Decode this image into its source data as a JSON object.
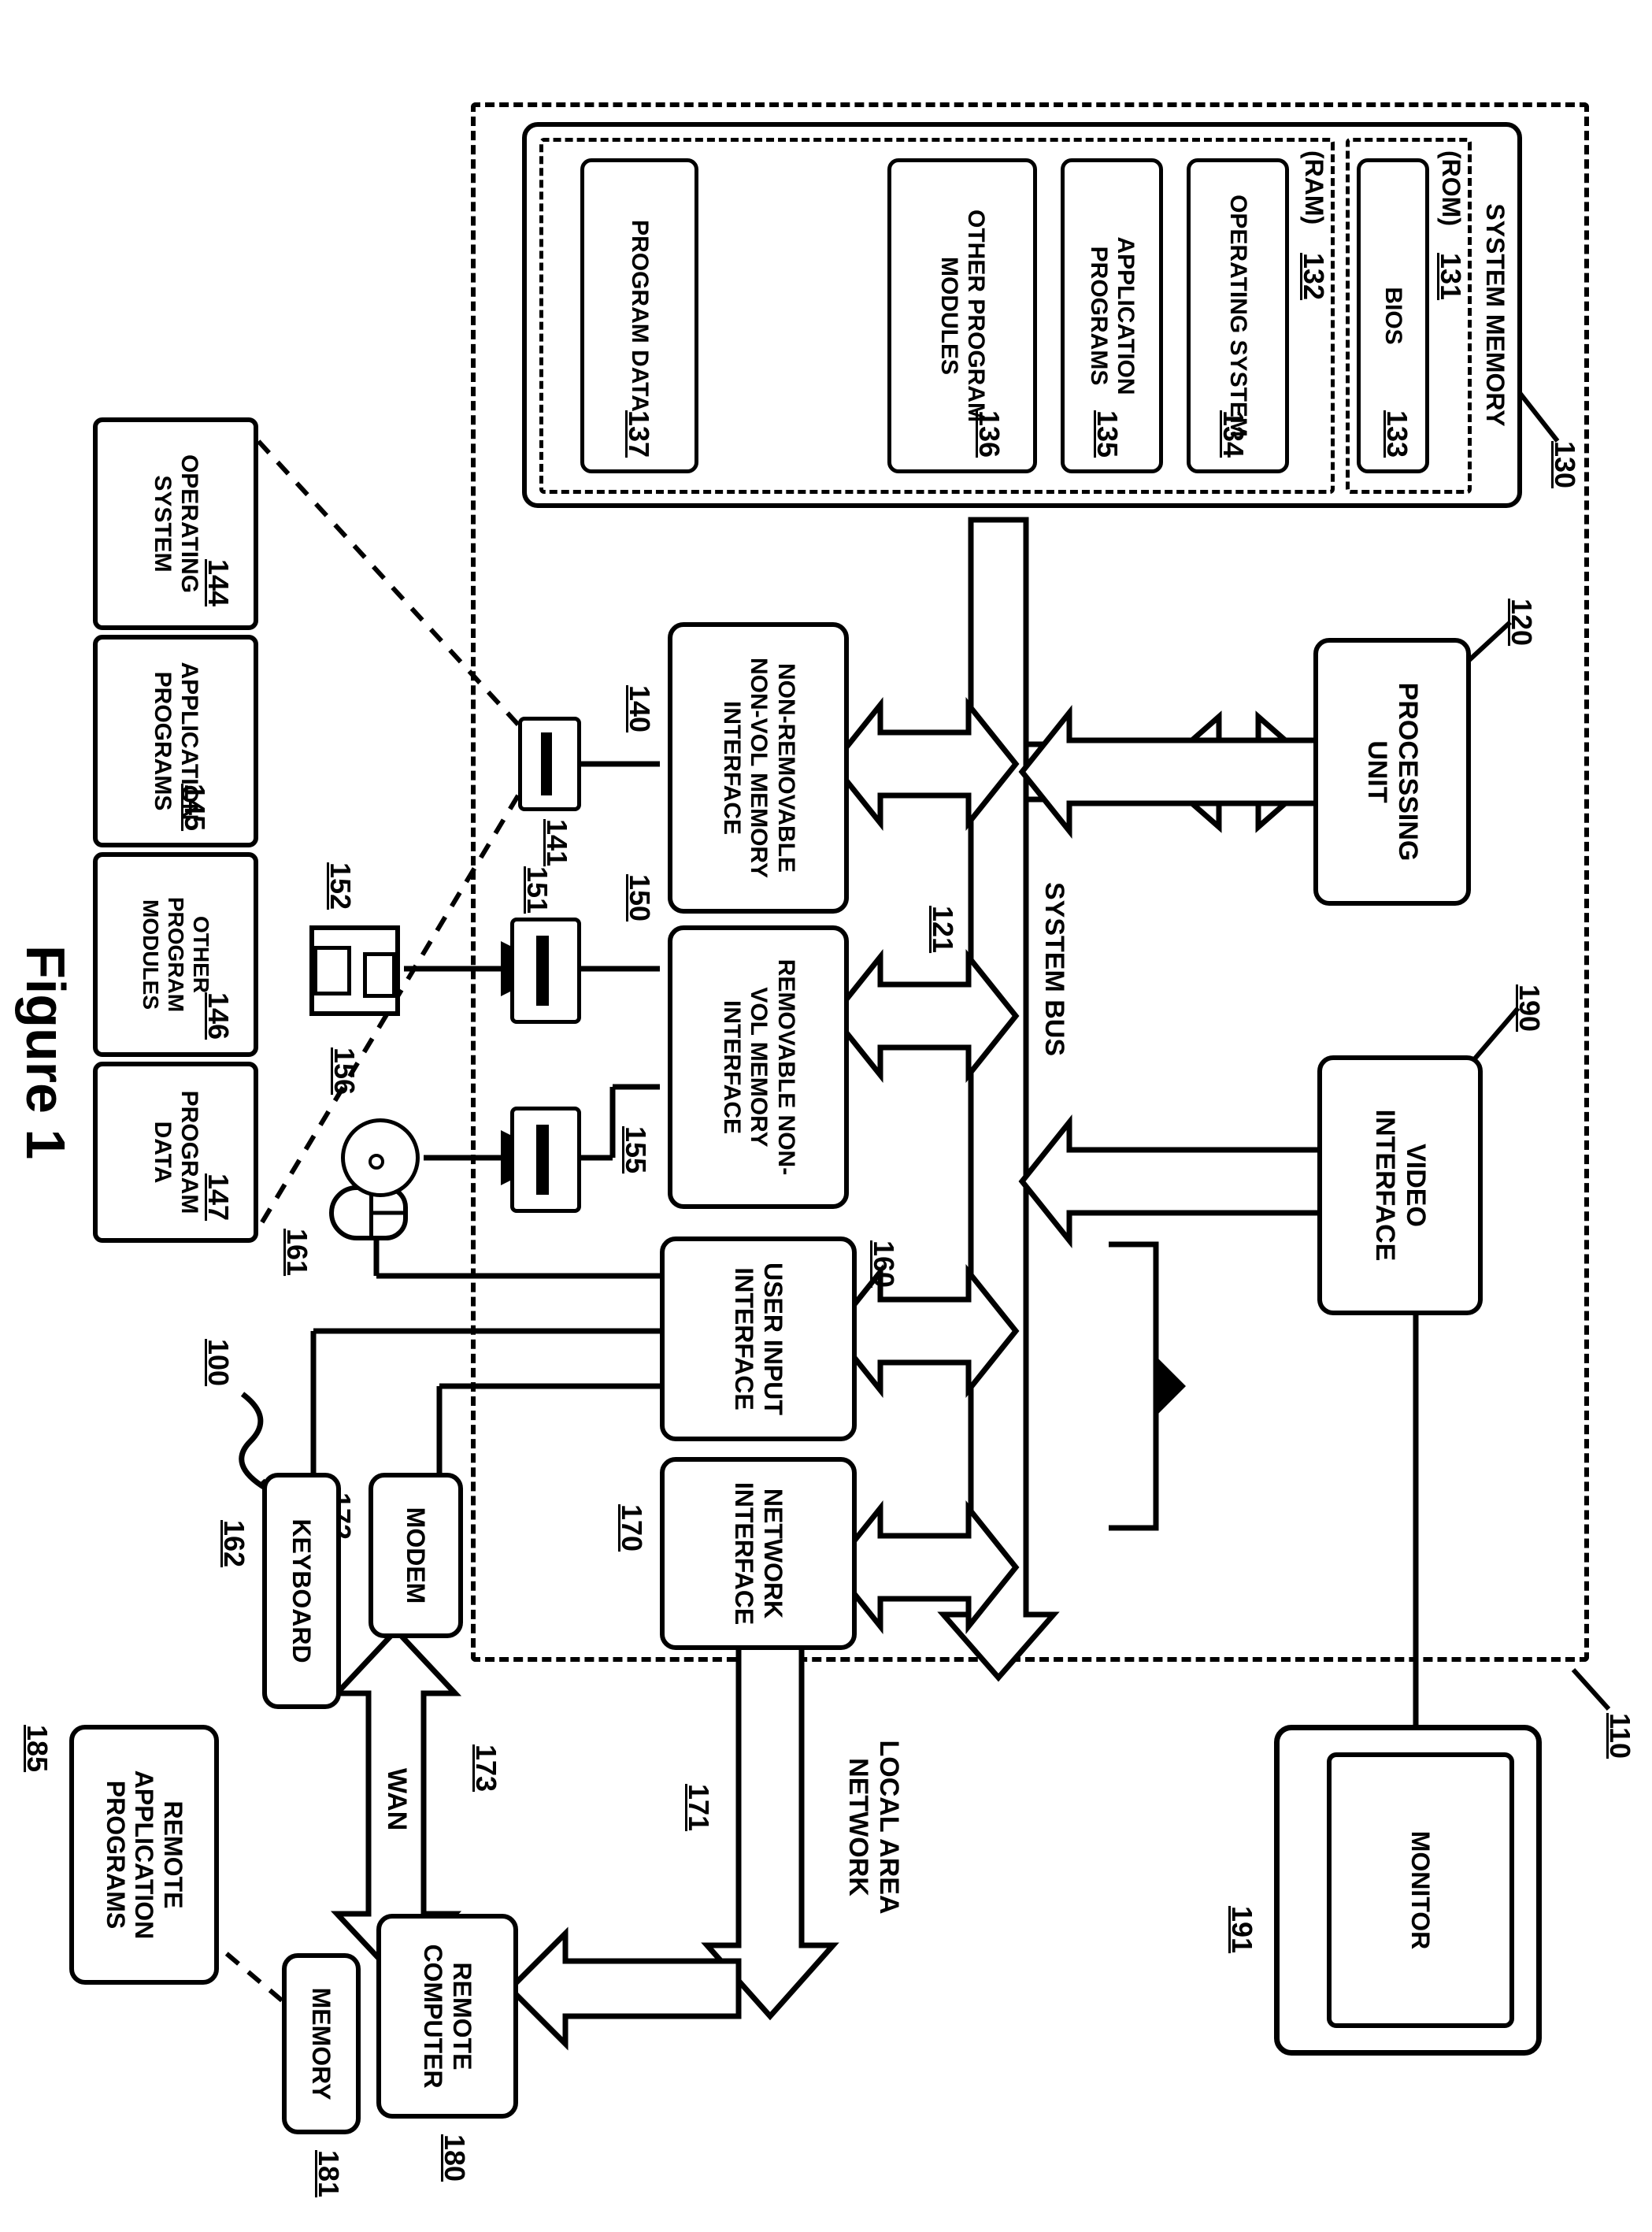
{
  "figure_title": "Figure 1",
  "refs": {
    "env": "100",
    "computer": "110",
    "processing_unit": "120",
    "system_bus": "121",
    "system_memory": "130",
    "rom": "131",
    "ram": "132",
    "bios": "133",
    "os_ram": "134",
    "apps_ram": "135",
    "other_ram": "136",
    "data_ram": "137",
    "nonrem_iface": "140",
    "hdd": "141",
    "os_disk": "144",
    "apps_disk": "145",
    "other_disk": "146",
    "data_disk": "147",
    "rem_iface": "150",
    "floppy_drive": "151",
    "floppy_disk": "152",
    "optical_drive": "155",
    "optical_disc": "156",
    "user_input_iface": "160",
    "mouse": "161",
    "keyboard": "162",
    "network_iface": "170",
    "lan": "171",
    "modem": "172",
    "wan": "173",
    "remote_computer": "180",
    "remote_memory": "181",
    "remote_apps": "185",
    "video_iface": "190",
    "monitor": "191"
  },
  "labels": {
    "system_memory": "SYSTEM MEMORY",
    "rom": "(ROM)",
    "ram": "(RAM)",
    "bios": "BIOS",
    "os": "OPERATING SYSTEM",
    "apps": "APPLICATION PROGRAMS",
    "other_modules": "OTHER PROGRAM MODULES",
    "program_data": "PROGRAM DATA",
    "processing_unit": "PROCESSING UNIT",
    "video_iface": "VIDEO INTERFACE",
    "system_bus": "SYSTEM BUS",
    "nonrem": "NON-REMOVABLE NON-VOL MEMORY INTERFACE",
    "rem": "REMOVABLE NON-VOL MEMORY INTERFACE",
    "uii": "USER INPUT INTERFACE",
    "net": "NETWORK INTERFACE",
    "monitor": "MONITOR",
    "lan": "LOCAL AREA NETWORK",
    "wan": "WAN",
    "modem": "MODEM",
    "keyboard": "KEYBOARD",
    "remote_computer": "REMOTE COMPUTER",
    "memory": "MEMORY",
    "remote_apps": "REMOTE APPLICATION PROGRAMS",
    "os_disk": "OPERATING SYSTEM",
    "apps_disk": "APPLICATION PROGRAMS",
    "other_disk": "OTHER PROGRAM MODULES",
    "data_disk": "PROGRAM DATA"
  }
}
